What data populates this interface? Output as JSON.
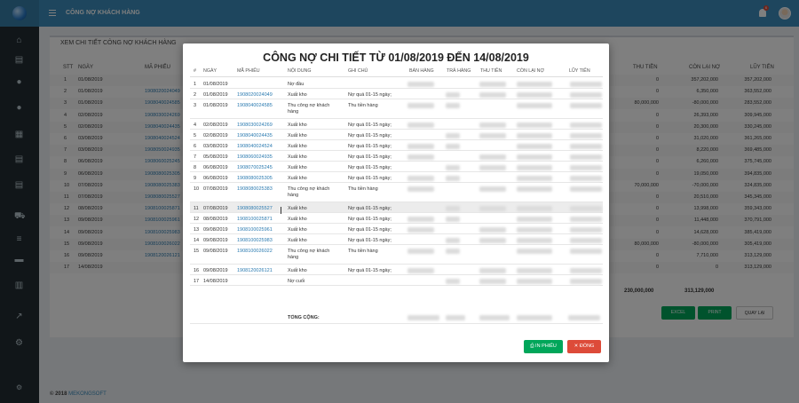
{
  "header": {
    "app_title": "CÔNG NỢ KHÁCH HÀNG",
    "notification_count": "6"
  },
  "sidebar": {
    "icons": [
      "home-icon",
      "table-icon",
      "user-icon",
      "user-icon",
      "grid-icon",
      "document-icon",
      "document-icon",
      "cart-icon",
      "database-icon",
      "money-icon",
      "bar-chart-icon",
      "line-chart-icon",
      "cogs-icon",
      "gear-icon"
    ]
  },
  "background": {
    "title": "XEM CHI TIẾT CÔNG NỢ KHÁCH HÀNG",
    "columns": [
      "STT",
      "NGÀY",
      "MÃ PHIẾU",
      "THU TIỀN",
      "CÒN LẠI NỢ",
      "LŨY TIẾN"
    ],
    "rows": [
      {
        "stt": "1",
        "date": "01/08/2019",
        "code": "",
        "thu": "0",
        "con_lai": "357,202,000",
        "luy_tien": "357,202,000"
      },
      {
        "stt": "2",
        "date": "01/08/2019",
        "code": "1908020024049",
        "thu": "0",
        "con_lai": "6,350,000",
        "luy_tien": "363,552,000"
      },
      {
        "stt": "3",
        "date": "01/08/2019",
        "code": "1908040024585",
        "thu": "80,000,000",
        "con_lai": "-80,000,000",
        "luy_tien": "283,552,000"
      },
      {
        "stt": "4",
        "date": "02/08/2019",
        "code": "1908030024269",
        "thu": "0",
        "con_lai": "26,393,000",
        "luy_tien": "309,945,000"
      },
      {
        "stt": "5",
        "date": "02/08/2019",
        "code": "1908040024435",
        "thu": "0",
        "con_lai": "20,300,000",
        "luy_tien": "330,245,000"
      },
      {
        "stt": "6",
        "date": "03/08/2019",
        "code": "1908040024524",
        "thu": "0",
        "con_lai": "31,020,000",
        "luy_tien": "361,265,000"
      },
      {
        "stt": "7",
        "date": "03/08/2019",
        "code": "1908050024935",
        "thu": "0",
        "con_lai": "8,220,000",
        "luy_tien": "369,485,000"
      },
      {
        "stt": "8",
        "date": "06/08/2019",
        "code": "1908060025245",
        "thu": "0",
        "con_lai": "6,260,000",
        "luy_tien": "375,745,000"
      },
      {
        "stt": "9",
        "date": "06/08/2019",
        "code": "1908080025305",
        "thu": "0",
        "con_lai": "19,050,000",
        "luy_tien": "394,835,000"
      },
      {
        "stt": "10",
        "date": "07/08/2019",
        "code": "1908080025383",
        "thu": "70,000,000",
        "con_lai": "-70,000,000",
        "luy_tien": "324,835,000"
      },
      {
        "stt": "11",
        "date": "07/08/2019",
        "code": "1908080025527",
        "thu": "0",
        "con_lai": "20,510,000",
        "luy_tien": "345,345,000"
      },
      {
        "stt": "12",
        "date": "08/08/2019",
        "code": "1908100025871",
        "thu": "0",
        "con_lai": "13,998,000",
        "luy_tien": "359,343,000"
      },
      {
        "stt": "13",
        "date": "09/08/2019",
        "code": "1908100025961",
        "thu": "0",
        "con_lai": "11,448,000",
        "luy_tien": "370,791,000"
      },
      {
        "stt": "14",
        "date": "09/08/2019",
        "code": "1908100025983",
        "thu": "0",
        "con_lai": "14,628,000",
        "luy_tien": "385,419,000"
      },
      {
        "stt": "15",
        "date": "09/08/2019",
        "code": "1908100026022",
        "thu": "80,000,000",
        "con_lai": "-80,000,000",
        "luy_tien": "305,419,000"
      },
      {
        "stt": "16",
        "date": "09/08/2019",
        "code": "1908120026121",
        "thu": "0",
        "con_lai": "7,710,000",
        "luy_tien": "313,129,000"
      },
      {
        "stt": "17",
        "date": "14/08/2019",
        "code": "",
        "thu": "0",
        "con_lai": "0",
        "luy_tien": "313,129,000"
      }
    ],
    "total_thu": "230,000,000",
    "total_con_lai": "313,129,000",
    "buttons": {
      "excel": "EXCEL",
      "print": "PRINT",
      "back": "QUAY LẠI"
    }
  },
  "footer": {
    "copyright": "© 2018",
    "brand": "MEKONGSOFT"
  },
  "modal": {
    "title": "CÔNG NỢ CHI TIẾT TỪ 01/08/2019 ĐẾN 14/08/2019",
    "columns": [
      "#",
      "NGÀY",
      "MÃ PHIẾU",
      "NỘI DUNG",
      "GHI CHÚ",
      "BÁN HÀNG",
      "TRẢ HÀNG",
      "THU TIỀN",
      "CÒN LẠI NỢ",
      "LŨY TIẾN"
    ],
    "rows": [
      {
        "no": "1",
        "date": "01/08/2019",
        "code": "",
        "content": "Nợ đầu",
        "note": ""
      },
      {
        "no": "2",
        "date": "01/08/2019",
        "code": "1908020024049",
        "content": "Xuất kho",
        "note": "Nợ quá 01-15 ngày;"
      },
      {
        "no": "3",
        "date": "01/08/2019",
        "code": "1908040024585",
        "content": "Thu công nợ khách hàng",
        "note": "Thu tiền hàng"
      },
      {
        "no": "4",
        "date": "02/08/2019",
        "code": "1908030024269",
        "content": "Xuất kho",
        "note": "Nợ quá 01-15 ngày;"
      },
      {
        "no": "5",
        "date": "02/08/2019",
        "code": "1908040024435",
        "content": "Xuất kho",
        "note": "Nợ quá 01-15 ngày;"
      },
      {
        "no": "6",
        "date": "03/08/2019",
        "code": "1908040024524",
        "content": "Xuất kho",
        "note": "Nợ quá 01-15 ngày;"
      },
      {
        "no": "7",
        "date": "05/08/2019",
        "code": "1908060024935",
        "content": "Xuất kho",
        "note": "Nợ quá 01-15 ngày;"
      },
      {
        "no": "8",
        "date": "06/08/2019",
        "code": "1908070025245",
        "content": "Xuất kho",
        "note": "Nợ quá 01-15 ngày;"
      },
      {
        "no": "9",
        "date": "06/08/2019",
        "code": "1908080025305",
        "content": "Xuất kho",
        "note": "Nợ quá 01-15 ngày;"
      },
      {
        "no": "10",
        "date": "07/08/2019",
        "code": "1908080025383",
        "content": "Thu công nợ khách hàng",
        "note": "Thu tiền hàng"
      },
      {
        "no": "11",
        "date": "07/08/2019",
        "code": "1908080025527",
        "content": "Xuất kho",
        "note": "Nợ quá 01-15 ngày;"
      },
      {
        "no": "12",
        "date": "08/08/2019",
        "code": "1908100025871",
        "content": "Xuất kho",
        "note": "Nợ quá 01-15 ngày;"
      },
      {
        "no": "13",
        "date": "09/08/2019",
        "code": "1908100025961",
        "content": "Xuất kho",
        "note": "Nợ quá 01-15 ngày;"
      },
      {
        "no": "14",
        "date": "09/08/2019",
        "code": "1908100025983",
        "content": "Xuất kho",
        "note": "Nợ quá 01-15 ngày;"
      },
      {
        "no": "15",
        "date": "09/08/2019",
        "code": "1908100026022",
        "content": "Thu công nợ khách hàng",
        "note": "Thu tiền hàng"
      },
      {
        "no": "16",
        "date": "09/08/2019",
        "code": "1908120026121",
        "content": "Xuất kho",
        "note": "Nợ quá 01-15 ngày;"
      },
      {
        "no": "17",
        "date": "14/08/2019",
        "code": "",
        "content": "Nợ cuối",
        "note": ""
      }
    ],
    "total_label": "TỔNG CỘNG:",
    "buttons": {
      "print": "IN PHIẾU",
      "close": "ĐÓNG"
    }
  },
  "colors": {
    "header": "#3c8dbc",
    "sidebar": "#222d32",
    "link": "#2a7ab0",
    "success": "#00a65a",
    "danger": "#dd4b39"
  }
}
